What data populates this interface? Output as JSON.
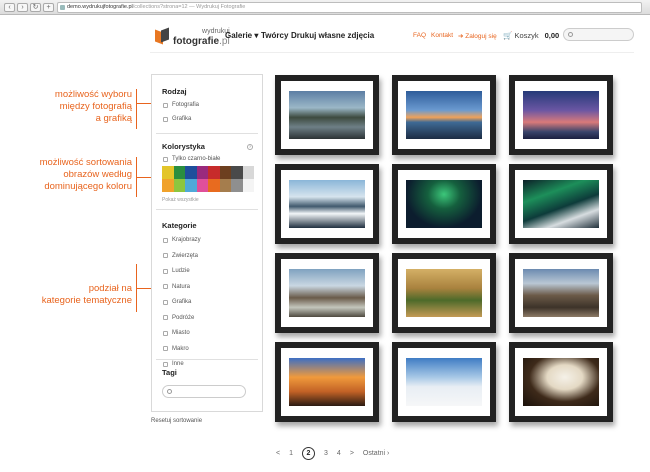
{
  "browser": {
    "url_main": "demo.wydrukujfotografie.pl",
    "url_rest": "/collections?strona=12 — Wydrukuj Fotografie"
  },
  "logo": {
    "small": "wydrukuj",
    "big": "fotografie",
    "tld": ".pl"
  },
  "nav": {
    "gallery": "Galerie",
    "creators": "Twórcy",
    "print": "Drukuj własne zdjęcia"
  },
  "top_links": {
    "faq": "FAQ",
    "contact": "Kontakt",
    "login": "Zaloguj się"
  },
  "cart": {
    "label": "Koszyk",
    "amount": "0,00"
  },
  "annotations": {
    "a1": [
      "możliwość wyboru",
      "między fotografią",
      "a grafiką"
    ],
    "a2": [
      "możliwość sortowania",
      "obrazów według",
      "dominującego koloru"
    ],
    "a3": [
      "podział na",
      "kategorie tematyczne"
    ]
  },
  "sidebar": {
    "type_title": "Rodzaj",
    "type_options": [
      "Fotografia",
      "Grafika"
    ],
    "color_title": "Kolorystyka",
    "bw_label": "Tylko czarno-białe",
    "show_all": "Pokaż wszystkie",
    "swatch_colors": [
      "#e3c52a",
      "#2a8e3f",
      "#1f4f9c",
      "#9a2a7d",
      "#c72b2b",
      "#6d3f1f",
      "#4a4a4a",
      "#d8d8d8",
      "#f0a22b",
      "#8dc63f",
      "#4fa9d9",
      "#e04f9a",
      "#e86b1f",
      "#a57d4d",
      "#8f8f8f",
      "#f4f4f4"
    ],
    "categories_title": "Kategorie",
    "categories": [
      "Krajobrazy",
      "Zwierzęta",
      "Ludzie",
      "Natura",
      "Grafika",
      "Podróże",
      "Miasto",
      "Makro",
      "Inne"
    ],
    "tags_title": "Tagi",
    "reset": "Resetuj sortowanie"
  },
  "gallery": [
    {
      "name": "photo-mountain-lake",
      "bg": "linear-gradient(#5c7ea4 0%, #9bb7c7 35%, #3d4a3f 55%, #6e7f86 75%, #2c3335 100%)"
    },
    {
      "name": "photo-sunset-boat",
      "bg": "linear-gradient(#2e5c9a 0%, #6b9ad0 40%, #f0a25a 55%, #3f6a95 65%, #1c2c44 100%)"
    },
    {
      "name": "photo-purple-dusk",
      "bg": "linear-gradient(#253a78 0%, #6a56a3 40%, #d97a7a 65%, #39446b 85%, #1b2040 100%)"
    },
    {
      "name": "photo-ice-shore",
      "bg": "linear-gradient(#8ab6d8 0%, #d6e4ee 35%, #40596d 55%, #f2f6f8 70%, #203040 100%)"
    },
    {
      "name": "photo-aurora-town",
      "bg": "radial-gradient(ellipse at 50% 30%, #3cc77a 0%, #15603e 30%, #0c1d2e 70%), linear-gradient(#0c1d2e, #0c1d2e)"
    },
    {
      "name": "photo-aurora-peak",
      "bg": "linear-gradient(160deg, #0c2028 0%, #1d8f5a 30%, #0d3b3a 55%, #d7dde0 75%, #20303a 100%)"
    },
    {
      "name": "photo-tree-branches",
      "bg": "linear-gradient(#7fa2c0 0%, #c9d7e2 35%, #6a5b4a 60%, #c3c6bc 80%, #4f4a40 100%)"
    },
    {
      "name": "photo-cypress-road",
      "bg": "linear-gradient(#d4b066 0%, #a9823e 40%, #4d6a2a 65%, #c49a55 100%)"
    },
    {
      "name": "photo-rocky-mountain",
      "bg": "linear-gradient(#6b8ab0 0%, #b9c7d4 30%, #6b5a48 55%, #3d3329 80%, #8c7a66 100%)"
    },
    {
      "name": "photo-city-skyline",
      "bg": "linear-gradient(#3d6fc3 0%, #f09a3c 40%, #c26226 70%, #2a1b12 100%)"
    },
    {
      "name": "photo-snow-sled",
      "bg": "linear-gradient(#3f7cc4 0%, #a7c8e6 40%, #e8eef4 60%, #f6f7f8 100%)"
    },
    {
      "name": "photo-window-cat",
      "bg": "radial-gradient(ellipse at 55% 40%, #f5f1e8 0%, #e4d9c4 30%, #3e2a1a 60%, #1a110a 100%)"
    }
  ],
  "pager": {
    "prev": "<",
    "pages": [
      "1",
      "2",
      "3",
      "4"
    ],
    "current": "2",
    "next": ">",
    "last": "Ostatni ›"
  }
}
